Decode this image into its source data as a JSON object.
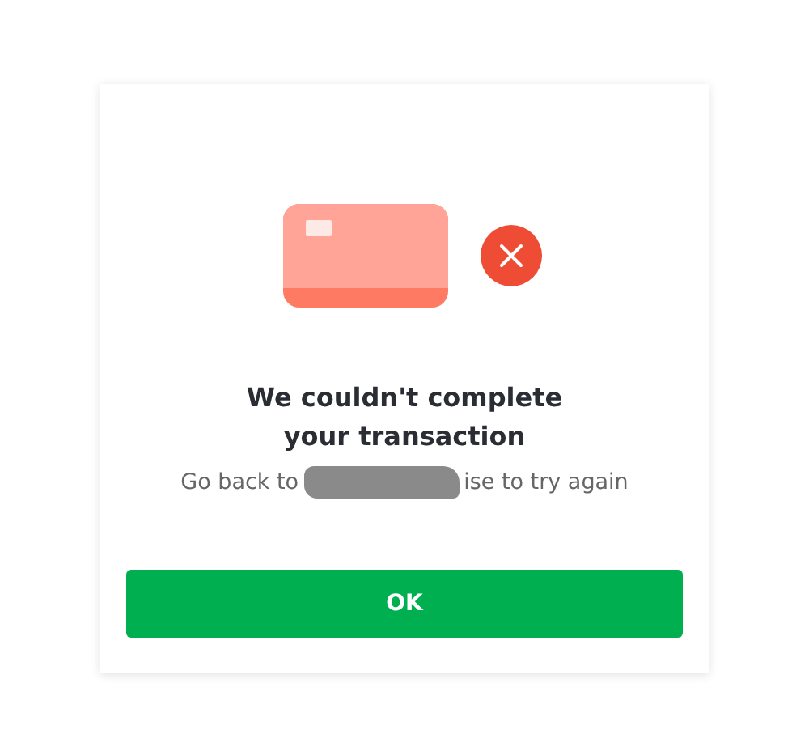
{
  "dialog": {
    "title": "We couldn't complete your transaction",
    "message": {
      "before": "Go back to",
      "redacted": true,
      "after": "ise to try again"
    },
    "button": "OK"
  }
}
